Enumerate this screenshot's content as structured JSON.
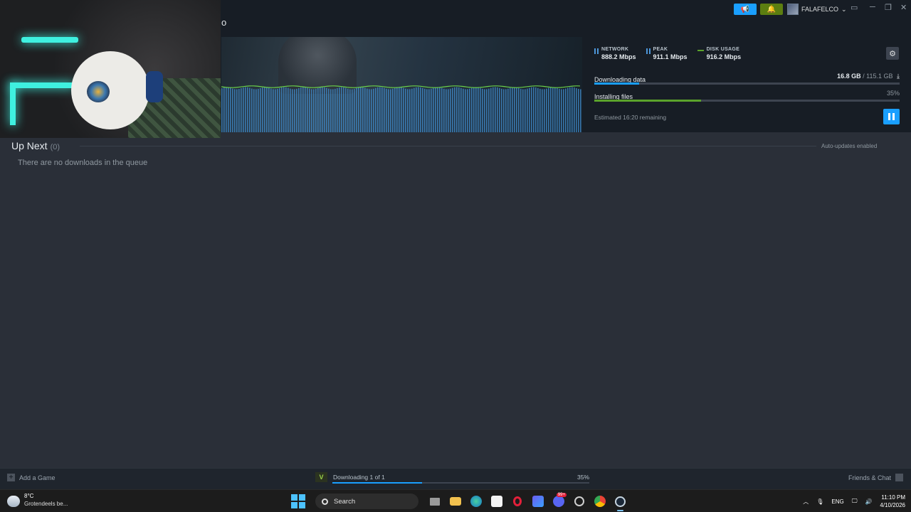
{
  "titlebar": {
    "title_fragment": "o",
    "username": "FALAFELCO",
    "user_chevron": "⌄"
  },
  "banner": {
    "stats": [
      {
        "label": "NETWORK",
        "value": "888.2 Mbps",
        "icon": "bar-chart-icon",
        "color": "#4d96d8"
      },
      {
        "label": "PEAK",
        "value": "911.1 Mbps",
        "icon": "bar-chart-icon",
        "color": "#4d96d8"
      },
      {
        "label": "DISK USAGE",
        "value": "916.2 Mbps",
        "icon": "line-icon",
        "color": "#5ba32b"
      }
    ],
    "downloading_label": "Downloading data",
    "downloaded_amount": "16.8 GB",
    "download_separator": " / ",
    "download_total": "115.1 GB",
    "download_progress": 0.146,
    "installing_label": "Installing files",
    "installing_percent": "35%",
    "installing_progress": 0.35,
    "eta": "Estimated 16:20 remaining"
  },
  "queue": {
    "title": "Up Next",
    "count": "(0)",
    "auto_updates": "Auto-updates enabled",
    "empty_message": "There are no downloads in the queue"
  },
  "bottombar": {
    "add_game": "Add a Game",
    "downloading_status": "Downloading 1 of 1",
    "percent": "35%",
    "progress": 0.35,
    "friends_chat": "Friends & Chat"
  },
  "taskbar": {
    "temperature": "8°C",
    "weather": "Grotendeels be...",
    "search_placeholder": "Search",
    "language": "ENG",
    "time": "11:10 PM",
    "date": "4/10/2026",
    "discord_badge": "99+"
  },
  "colors": {
    "accent": "#1a9fff",
    "green": "#5ba32b",
    "bell": "#5c7e10"
  }
}
